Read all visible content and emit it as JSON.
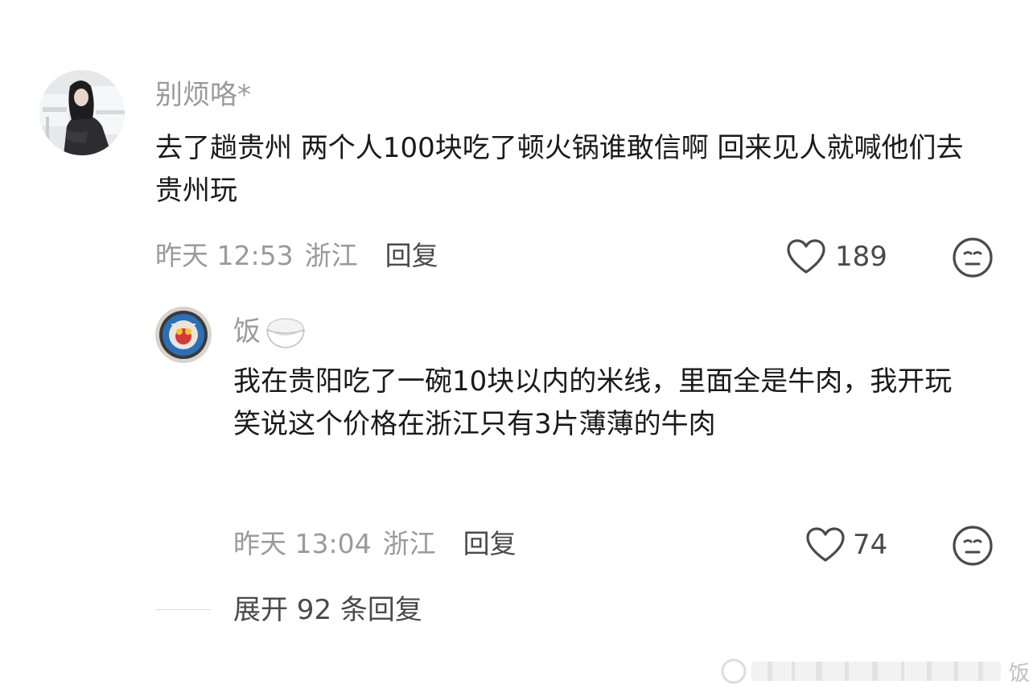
{
  "comments": [
    {
      "username": "别烦咯*",
      "text": "去了趟贵州 两个人100块吃了顿火锅谁敢信啊 回来见人就喊他们去贵州玩",
      "time": "昨天 12:53",
      "location": "浙江",
      "reply_label": "回复",
      "likes": "189",
      "avatar_icon": "avatar-girl-photo",
      "like_icon": "heart-outline",
      "react_icon": "neutral-face"
    },
    {
      "username": "饭",
      "username_emoji": "🍚",
      "text": "我在贵阳吃了一碗10块以内的米线，里面全是牛肉，我开玩笑说这个价格在浙江只有3片薄薄的牛肉",
      "time": "昨天 13:04",
      "location": "浙江",
      "reply_label": "回复",
      "likes": "74",
      "avatar_icon": "avatar-manhole-cover",
      "like_icon": "heart-outline",
      "react_icon": "neutral-face"
    }
  ],
  "expand_replies": "展开 92 条回复",
  "watermark": "饭",
  "colors": {
    "text_primary": "#1a1a1a",
    "text_secondary": "#9a9a9a",
    "text_action": "#4a4a4a",
    "icon": "#4a4a4a"
  }
}
